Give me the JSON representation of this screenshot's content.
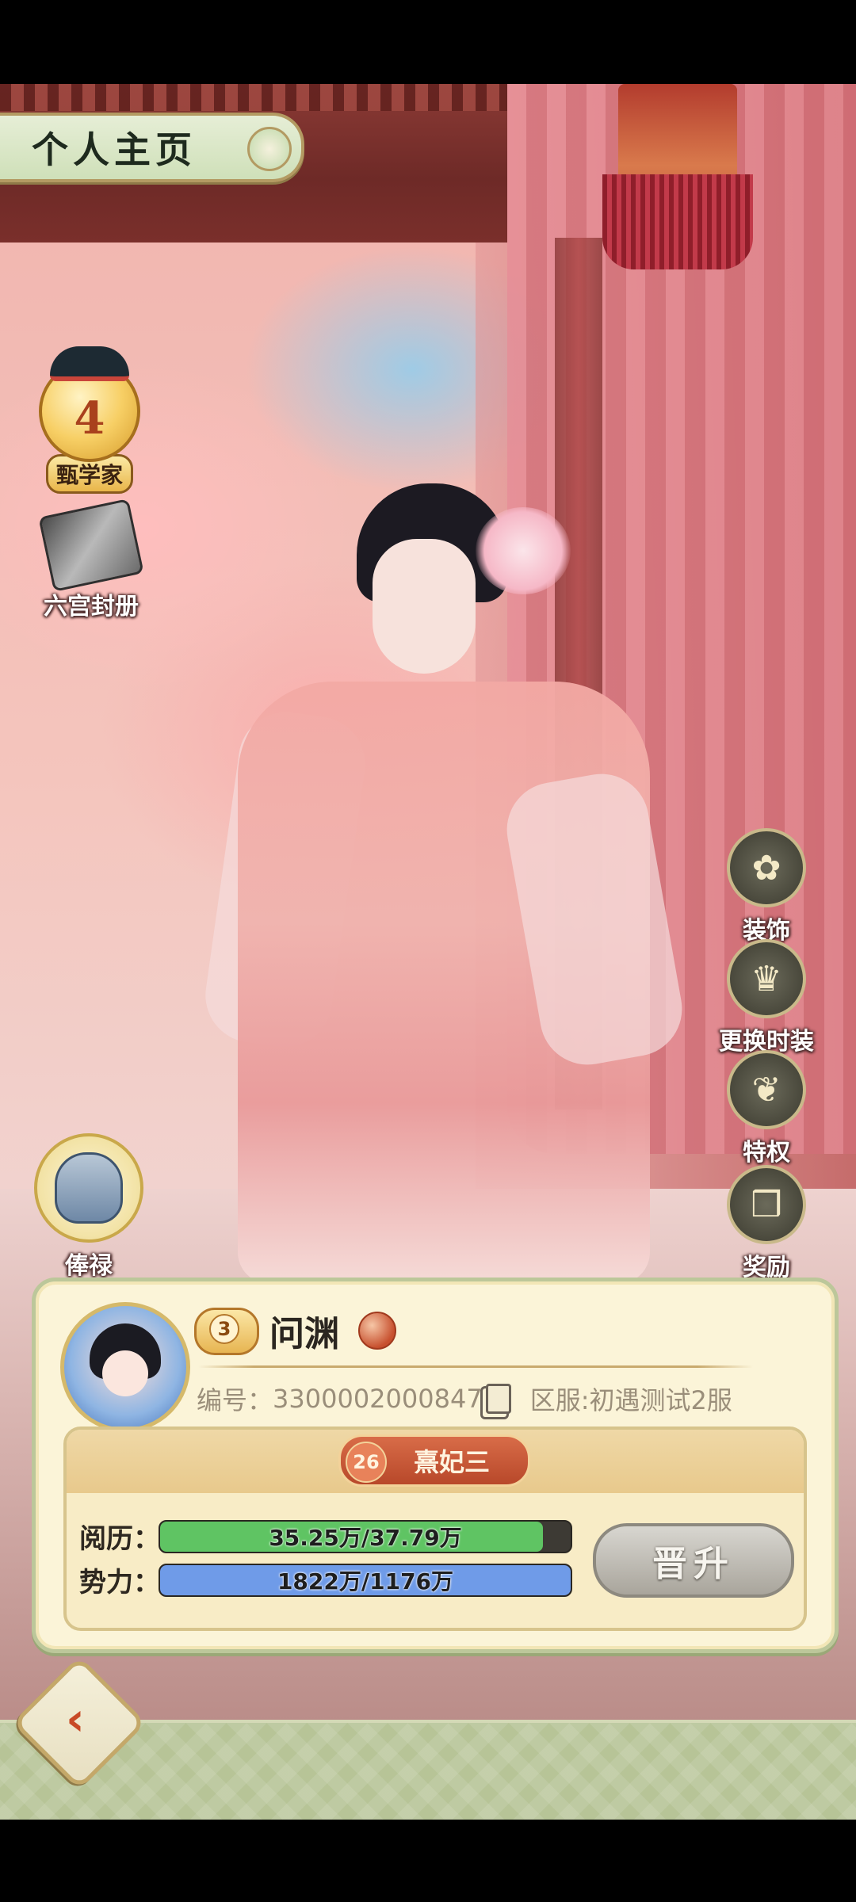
{
  "header": {
    "title": "个人主页"
  },
  "left_icons": {
    "rank_badge": {
      "number": "4",
      "label": "甄学家"
    },
    "book": {
      "label": "六宫封册"
    },
    "salary": {
      "label": "俸禄"
    }
  },
  "right_icons": [
    {
      "label": "装饰",
      "icon": "hairpin-icon"
    },
    {
      "label": "更换时装",
      "icon": "garment-icon"
    },
    {
      "label": "特权",
      "icon": "phoenix-icon"
    },
    {
      "label": "奖励",
      "icon": "gift-box-icon"
    }
  ],
  "profile": {
    "level": "3",
    "name": "问渊",
    "id_label": "编号：",
    "id_value": "3300002000847",
    "server": "区服:初遇测试2服",
    "rank_number": "26",
    "rank_title": "熹妃三"
  },
  "stats": [
    {
      "label": "阅历：",
      "text": "35.25万/37.79万",
      "current": 35.25,
      "max": 37.79,
      "color": "#5fc463"
    },
    {
      "label": "势力：",
      "text": "1822万/1176万",
      "current": 1822,
      "max": 1176,
      "color": "#6f9be8"
    }
  ],
  "actions": {
    "promote": "晋升"
  },
  "colors": {
    "accent_red": "#c84a26",
    "panel_bg": "#fbf4d8",
    "bar_green": "#5fc463",
    "bar_blue": "#6f9be8"
  }
}
